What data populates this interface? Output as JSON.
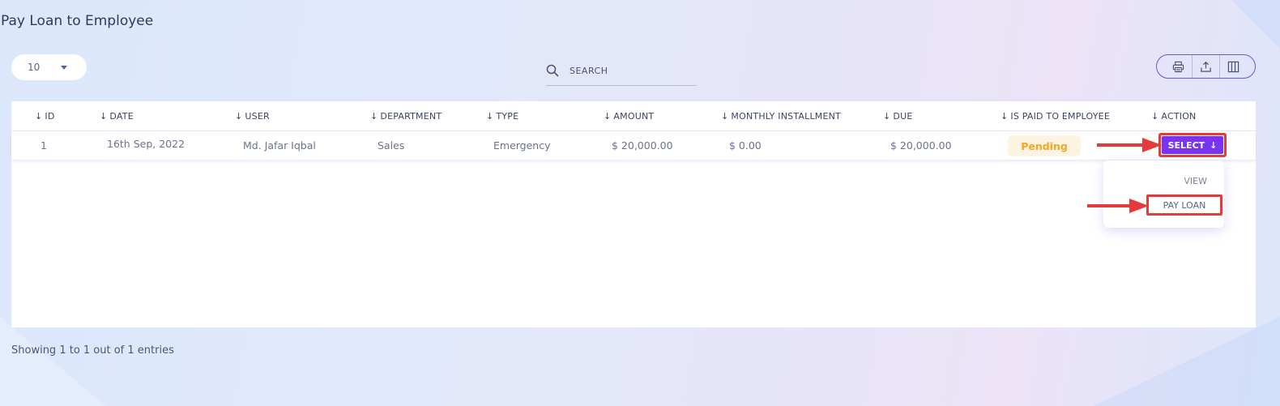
{
  "page": {
    "title": "Pay Loan to Employee"
  },
  "toolbar": {
    "page_size": "10",
    "search_placeholder": "SEARCH",
    "tools": [
      "print-icon",
      "export-icon",
      "columns-icon"
    ]
  },
  "table": {
    "columns": [
      "ID",
      "DATE",
      "USER",
      "DEPARTMENT",
      "TYPE",
      "AMOUNT",
      "MONTHLY INSTALLMENT",
      "DUE",
      "IS PAID TO EMPLOYEE",
      "ACTION"
    ],
    "rows": [
      {
        "id": "1",
        "date": "16th Sep, 2022",
        "user": "Md. Jafar Iqbal",
        "department": "Sales",
        "type": "Emergency",
        "amount": "$ 20,000.00",
        "monthly_installment": "$ 0.00",
        "due": "$ 20,000.00",
        "status": "Pending",
        "action_label": "SELECT"
      }
    ]
  },
  "action_menu": {
    "view": "VIEW",
    "pay_loan": "PAY LOAN"
  },
  "footer": {
    "entries_text": "Showing 1 to 1 out of 1 entries"
  },
  "colors": {
    "accent": "#7a34f0",
    "annotation": "#e33b3b",
    "pending": "#f5a623"
  }
}
